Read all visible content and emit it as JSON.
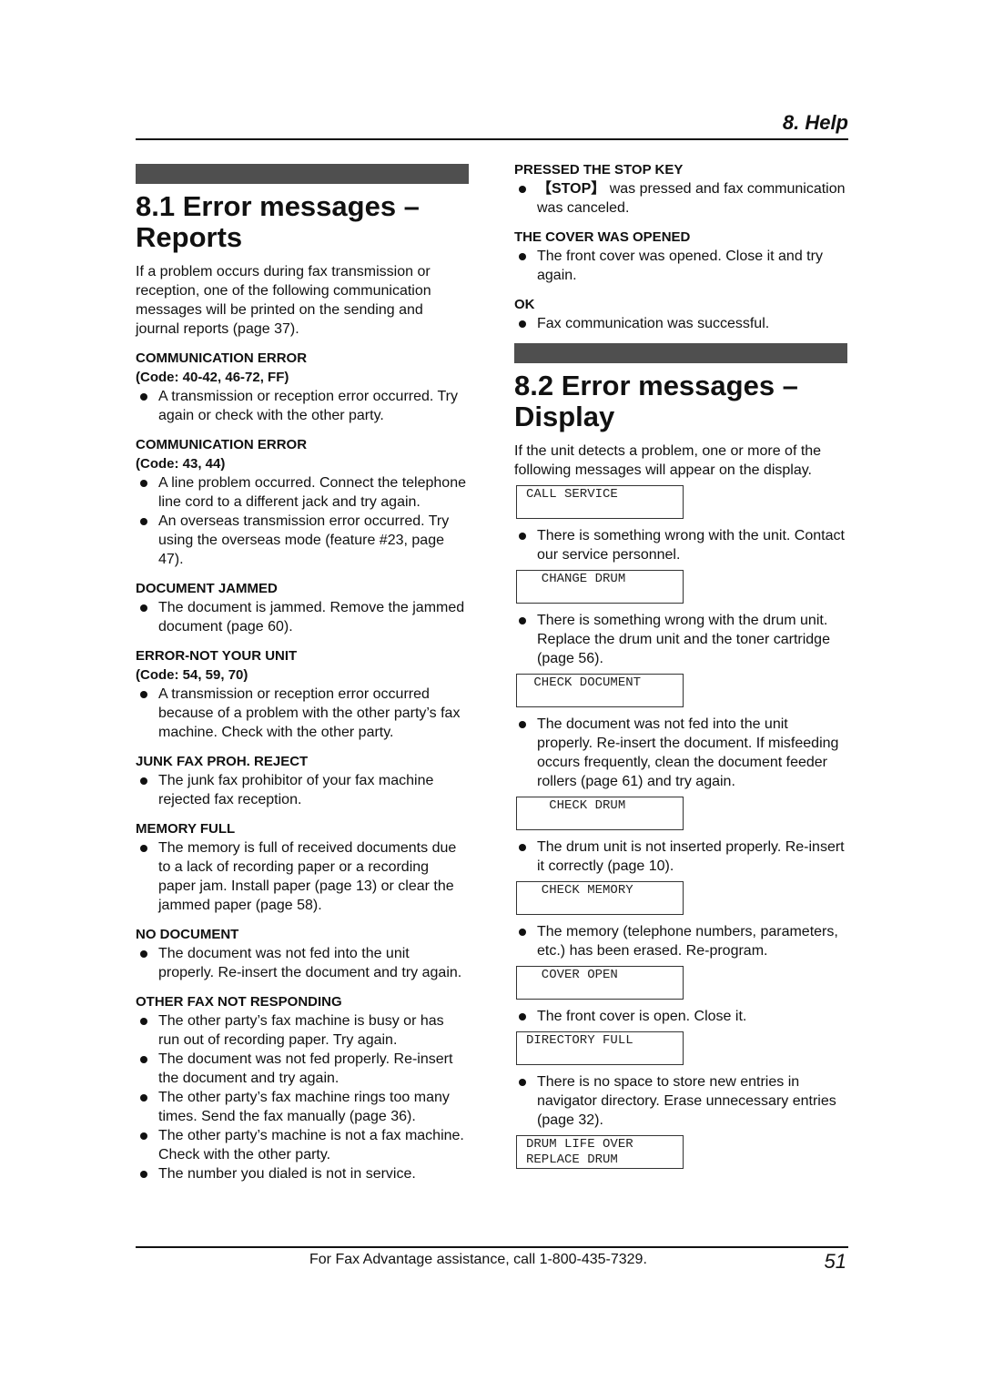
{
  "header": {
    "chapter": "8. Help"
  },
  "section1": {
    "title_line1": "8.1 Error messages –",
    "title_line2": "Reports",
    "intro": "If a problem occurs during fax transmission or reception, one of the following communication messages will be printed on the sending and journal reports (page 37).",
    "messages": [
      {
        "title": "COMMUNICATION ERROR",
        "code": "(Code: 40-42, 46-72, FF)",
        "bullets": [
          "A transmission or reception error occurred. Try again or check with the other party."
        ]
      },
      {
        "title": "COMMUNICATION ERROR",
        "code": "(Code: 43, 44)",
        "bullets": [
          "A line problem occurred. Connect the telephone line cord to a different jack and try again.",
          "An overseas transmission error occurred. Try using the overseas mode (feature #23, page 47)."
        ]
      },
      {
        "title": "DOCUMENT JAMMED",
        "bullets": [
          "The document is jammed. Remove the jammed document (page 60)."
        ]
      },
      {
        "title": "ERROR-NOT YOUR UNIT",
        "code": "(Code: 54, 59, 70)",
        "bullets": [
          "A transmission or reception error occurred because of a problem with the other party’s fax machine. Check with the other party."
        ]
      },
      {
        "title": "JUNK FAX PROH. REJECT",
        "bullets": [
          "The junk fax prohibitor of your fax machine rejected fax reception."
        ]
      },
      {
        "title": "MEMORY FULL",
        "bullets": [
          "The memory is full of received documents due to a lack of recording paper or a recording paper jam. Install paper (page 13) or clear the jammed paper (page 58)."
        ]
      },
      {
        "title": "NO DOCUMENT",
        "bullets": [
          "The document was not fed into the unit properly. Re-insert the document and try again."
        ]
      },
      {
        "title": "OTHER FAX NOT RESPONDING",
        "bullets": [
          "The other party’s fax machine is busy or has run out of recording paper. Try again.",
          "The document was not fed properly. Re-insert the document and try again.",
          "The other party’s fax machine rings too many times. Send the fax manually (page 36).",
          "The other party’s machine is not a fax machine. Check with the other party.",
          "The number you dialed is not in service."
        ]
      },
      {
        "title": "PRESSED THE STOP KEY",
        "bullets": [
          {
            "key": "【STOP】",
            "text": " was pressed and fax communication was canceled."
          }
        ]
      },
      {
        "title": "THE COVER WAS OPENED",
        "bullets": [
          "The front cover was opened. Close it and try again."
        ]
      },
      {
        "title": "OK",
        "bullets": [
          "Fax communication was successful."
        ]
      }
    ]
  },
  "section2": {
    "title_line1": "8.2 Error messages –",
    "title_line2": "Display",
    "intro": "If the unit detects a problem, one or more of the following messages will appear on the display.",
    "displays": [
      {
        "lcd": "CALL SERVICE",
        "bullets": [
          "There is something wrong with the unit. Contact our service personnel."
        ]
      },
      {
        "lcd": "  CHANGE DRUM",
        "bullets": [
          "There is something wrong with the drum unit. Replace the drum unit and the toner cartridge (page 56)."
        ]
      },
      {
        "lcd": " CHECK DOCUMENT",
        "bullets": [
          "The document was not fed into the unit properly. Re-insert the document. If misfeeding occurs frequently, clean the document feeder rollers (page 61) and try again."
        ]
      },
      {
        "lcd": "   CHECK DRUM",
        "bullets": [
          "The drum unit is not inserted properly. Re-insert it correctly (page 10)."
        ]
      },
      {
        "lcd": "  CHECK MEMORY",
        "bullets": [
          "The memory (telephone numbers, parameters, etc.) has been erased. Re-program."
        ]
      },
      {
        "lcd": "  COVER OPEN",
        "bullets": [
          "The front cover is open. Close it."
        ]
      },
      {
        "lcd": "DIRECTORY FULL",
        "bullets": [
          "There is no space to store new entries in navigator directory. Erase unnecessary entries (page 32)."
        ]
      },
      {
        "lcd": "DRUM LIFE OVER\nREPLACE DRUM",
        "bullets": []
      }
    ]
  },
  "footer": {
    "assistance": "For Fax Advantage assistance, call 1-800-435-7329.",
    "page_number": "51"
  }
}
